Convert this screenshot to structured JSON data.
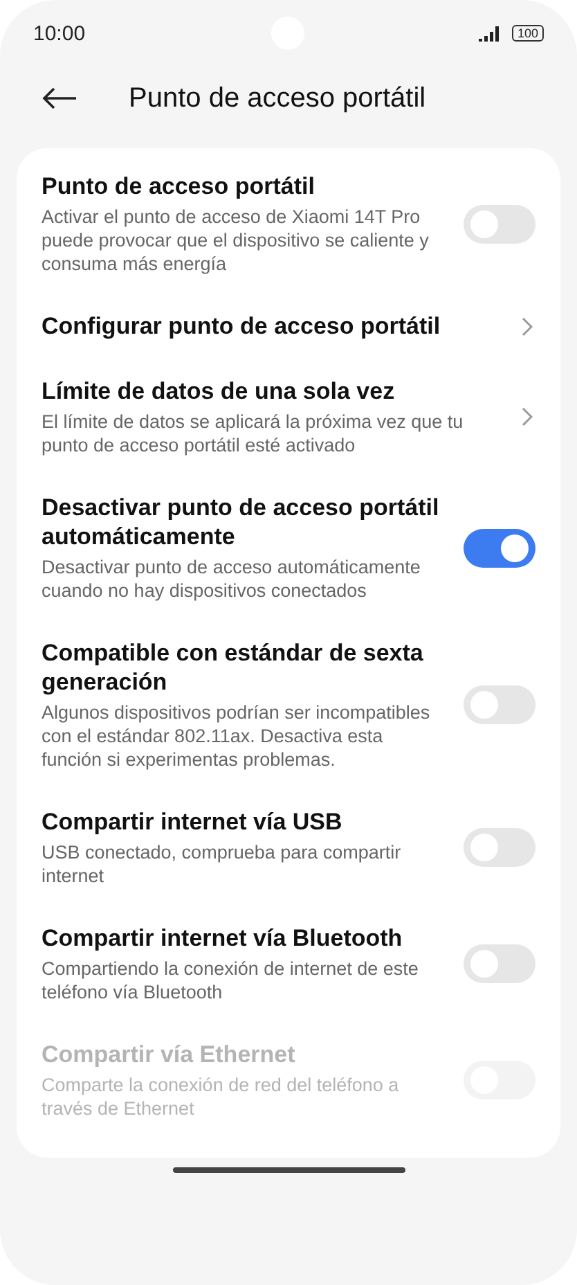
{
  "status_bar": {
    "time": "10:00",
    "battery": "100"
  },
  "header": {
    "title": "Punto de acceso portátil"
  },
  "settings": [
    {
      "kind": "toggle",
      "title": "Punto de acceso portátil",
      "description": "Activar el punto de acceso de Xiaomi 14T Pro puede provocar que el dispositivo se caliente y consuma más energía",
      "on": false,
      "disabled": false
    },
    {
      "kind": "link",
      "title": "Configurar punto de acceso portátil",
      "disabled": false
    },
    {
      "kind": "link",
      "title": "Límite de datos de una sola vez",
      "description": "El límite de datos se aplicará la próxima vez que tu punto de acceso portátil esté activado",
      "disabled": false
    },
    {
      "kind": "toggle",
      "title": "Desactivar punto de acceso portátil automáticamente",
      "description": "Desactivar punto de acceso automáticamente cuando no hay dispositivos conectados",
      "on": true,
      "disabled": false
    },
    {
      "kind": "toggle",
      "title": "Compatible con estándar de sexta generación",
      "description": "Algunos dispositivos podrían ser incompatibles con el estándar 802.11ax. Desactiva esta función si experimentas problemas.",
      "on": false,
      "disabled": false
    },
    {
      "kind": "toggle",
      "title": "Compartir internet vía USB",
      "description": "USB conectado, comprueba para compartir internet",
      "on": false,
      "disabled": false
    },
    {
      "kind": "toggle",
      "title": "Compartir internet vía Bluetooth",
      "description": "Compartiendo la conexión de internet de este teléfono vía Bluetooth",
      "on": false,
      "disabled": false
    },
    {
      "kind": "toggle",
      "title": "Compartir vía Ethernet",
      "description": "Comparte la conexión de red del teléfono a través de Ethernet",
      "on": false,
      "disabled": true
    }
  ]
}
